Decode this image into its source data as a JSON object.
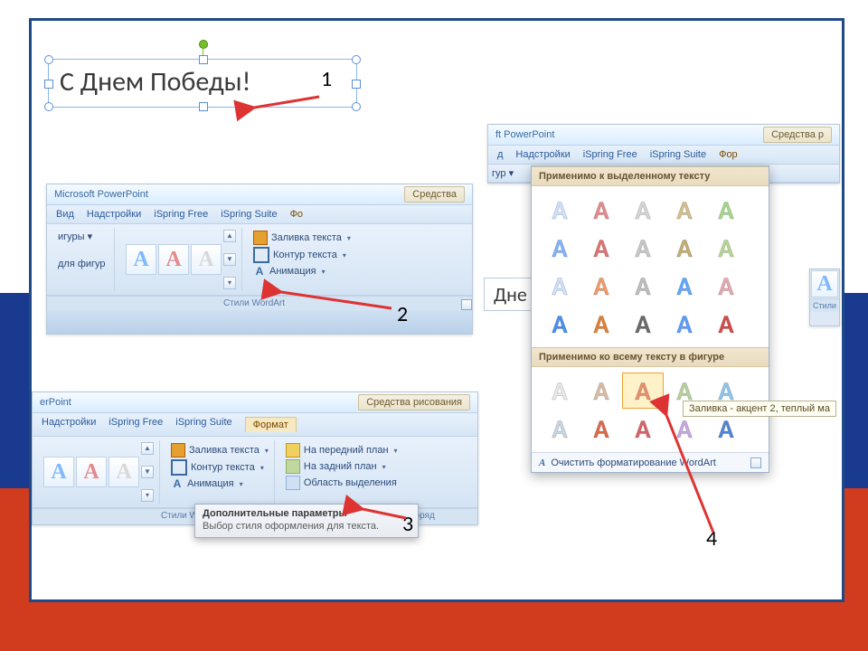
{
  "annotations": {
    "a1": "1",
    "a2": "2",
    "a3": "3",
    "a4": "4"
  },
  "textbox": {
    "content": "С Днем Победы!"
  },
  "panel2": {
    "app_title": "Microsoft PowerPoint",
    "context_tab": "Средства",
    "tabs": [
      "Вид",
      "Надстройки",
      "iSpring Free",
      "iSpring Suite",
      "Фо"
    ],
    "left_labels": [
      "игуры ▾",
      "для фигур"
    ],
    "group_label": "Стили WordArt",
    "cmds": {
      "fill": "Заливка текста",
      "outline": "Контур текста",
      "anim": "Анимация"
    }
  },
  "panel3": {
    "app_title": "erPoint",
    "context_tab": "Средства рисования",
    "tabs": [
      "Надстройки",
      "iSpring Free",
      "iSpring Suite",
      "Формат"
    ],
    "group_label": "Стили WordArt",
    "group_label2": "Упоряд",
    "cmds": {
      "fill": "Заливка текста",
      "outline": "Контур текста",
      "anim": "Анимация",
      "front": "На передний план",
      "back": "На задний план",
      "select": "Область выделения"
    },
    "tooltip": {
      "title": "Дополнительные параметры",
      "body": "Выбор стиля оформления для текста."
    }
  },
  "panel4": {
    "app_title": "ft PowerPoint",
    "context_tab": "Средства р",
    "tabs": [
      "д",
      "Надстройки",
      "iSpring Free",
      "iSpring Suite",
      "Фор"
    ],
    "left_label": "гур ▾",
    "stage_text": "Дне",
    "section1": "Применимо к выделенному тексту",
    "section2": "Применимо ко всему тексту в фигуре",
    "clear": "Очистить форматирование WordArt",
    "side_label": "Стили",
    "tooltip": "Заливка - акцент 2, теплый ма"
  },
  "wa_colors_1": [
    [
      "#cfe2ff",
      "#e58a8a",
      "#d6d6d6",
      "#d4c08e",
      "#a4d88c"
    ],
    [
      "#7fb4ff",
      "#e07272",
      "#c8c8c8",
      "#c4ae72",
      "#b7d693"
    ],
    [
      "#cfe2ff",
      "#f29b6a",
      "#bfbfbf",
      "#5fa8ff",
      "#e4aab1"
    ],
    [
      "#4a8ff0",
      "#e38035",
      "#6a6a6a",
      "#5a9dff",
      "#d44a4a"
    ]
  ],
  "wa_colors_2": [
    [
      "#eaeaea",
      "#d9bda4",
      "#e98f6a",
      "#b7d29e",
      "#8ec5ef"
    ],
    [
      "#c9d8e6",
      "#dc6a4a",
      "#d8636a",
      "#c6a8e0",
      "#4f84d8"
    ]
  ]
}
